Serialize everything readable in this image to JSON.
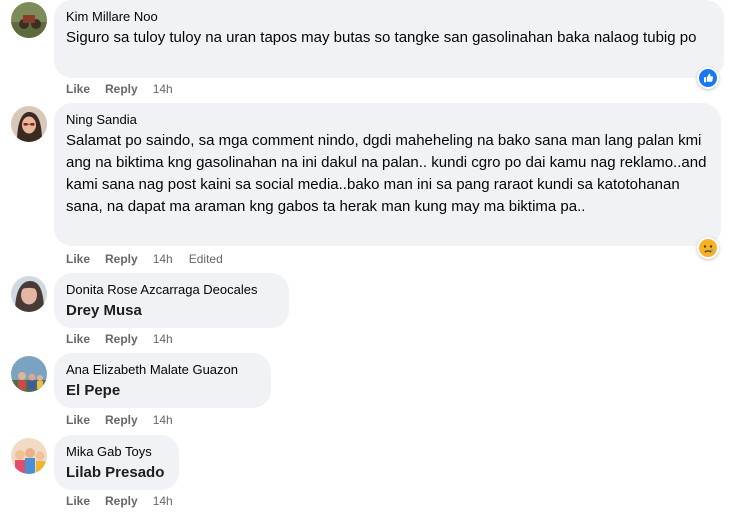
{
  "colors": {
    "bubble_bg": "#f0f2f5",
    "text": "#050505",
    "secondary_text": "#65676b",
    "like_blue": "#1877f2",
    "sad_yellow": "#f7b125"
  },
  "comments": [
    {
      "author": "Kim Millare Noo",
      "text": "Siguro sa tuloy tuloy na uran tapos may butas so tangke san gasolinahan baka nalaog tubig po",
      "like_label": "Like",
      "reply_label": "Reply",
      "time": "14h",
      "reaction_icon": "like-reaction-icon"
    },
    {
      "author": "Ning Sandia",
      "text": "Salamat po saindo, sa mga comment nindo, dgdi maheheling na bako sana man lang palan kmi ang na biktima kng gasolinahan na ini dakul na palan.. kundi cgro po dai kamu nag reklamo..and kami sana nag post kaini sa social media..bako man ini sa pang raraot kundi sa katotohanan sana, na dapat ma araman kng gabos ta herak man kung may ma biktima pa..",
      "like_label": "Like",
      "reply_label": "Reply",
      "time": "14h",
      "edited": "Edited",
      "reaction_icon": "sad-reaction-icon"
    },
    {
      "author": "Donita Rose Azcarraga Deocales",
      "text": "Drey Musa",
      "like_label": "Like",
      "reply_label": "Reply",
      "time": "14h"
    },
    {
      "author": "Ana Elizabeth Malate Guazon",
      "text": "El Pepe",
      "like_label": "Like",
      "reply_label": "Reply",
      "time": "14h"
    },
    {
      "author": "Mika Gab Toys",
      "text": "Lilab Presado",
      "like_label": "Like",
      "reply_label": "Reply",
      "time": "14h"
    }
  ]
}
